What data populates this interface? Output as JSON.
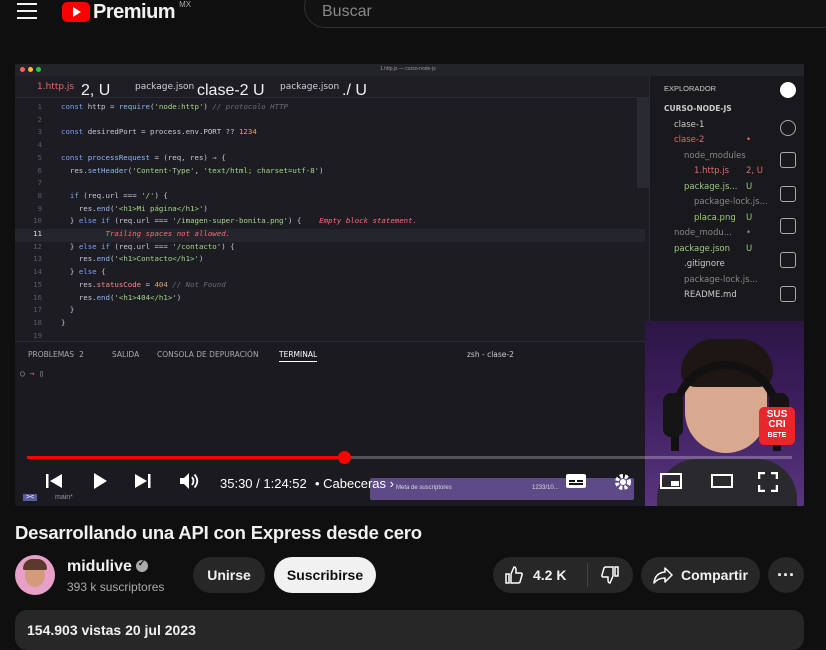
{
  "header": {
    "logo_text": "Premium",
    "logo_sup": "MX",
    "search_placeholder": "Buscar"
  },
  "editor": {
    "window_title": "1.http.js — curso-node-js",
    "tabs": [
      {
        "label": "1.http.js",
        "sub": "2, U",
        "active": true
      },
      {
        "label": "package.json",
        "sub": "clase-2  U",
        "active": false
      },
      {
        "label": "package.json",
        "sub": "./ U",
        "active": false
      }
    ],
    "lines": [
      {
        "n": "1",
        "html": "<span class='kw'>const</span> http = <span class='fn'>require</span>(<span class='str'>'node:http'</span>) <span class='cm'>// protocolo HTTP</span>"
      },
      {
        "n": "2",
        "html": ""
      },
      {
        "n": "3",
        "html": "<span class='kw'>const</span> desiredPort = process.env.PORT ?? <span class='num'>1234</span>"
      },
      {
        "n": "4",
        "html": ""
      },
      {
        "n": "5",
        "html": "<span class='kw'>const</span> <span class='fn'>processRequest</span> = (req, res) ⇒ {"
      },
      {
        "n": "6",
        "html": "  res.<span class='fn'>setHeader</span>(<span class='str'>'Content-Type'</span>, <span class='str'>'text/html; charset=utf-8'</span>)"
      },
      {
        "n": "7",
        "html": ""
      },
      {
        "n": "8",
        "html": "  <span class='kw'>if</span> (req.url === <span class='str'>'/'</span>) {"
      },
      {
        "n": "9",
        "html": "    res.<span class='fn'>end</span>(<span class='str'>'&lt;h1&gt;Mi página&lt;/h1&gt;'</span>)"
      },
      {
        "n": "10",
        "html": "  } <span class='kw'>else if</span> (req.url === <span class='str'>'/imagen-super-bonita.png'</span>) {    <span class='err'>Empty block statement.</span>"
      },
      {
        "n": "11",
        "html": "          <span class='err'>Trailing spaces not allowed.</span>"
      },
      {
        "n": "12",
        "html": "  } <span class='kw'>else if</span> (req.url === <span class='str'>'/contacto'</span>) {"
      },
      {
        "n": "13",
        "html": "    res.<span class='fn'>end</span>(<span class='str'>'&lt;h1&gt;Contacto&lt;/h1&gt;'</span>)"
      },
      {
        "n": "14",
        "html": "  } <span class='kw'>else</span> {"
      },
      {
        "n": "15",
        "html": "    res.<span class='prop'>statusCode</span> = <span class='num'>404</span> <span class='cm'>// Not Found</span>"
      },
      {
        "n": "16",
        "html": "    res.<span class='fn'>end</span>(<span class='str'>'&lt;h1&gt;404&lt;/h1&gt;'</span>)"
      },
      {
        "n": "17",
        "html": "  }"
      },
      {
        "n": "18",
        "html": "}"
      },
      {
        "n": "19",
        "html": ""
      }
    ],
    "explorer_title": "EXPLORADOR",
    "tree": [
      {
        "label": "CURSO-NODE-JS",
        "indent": 0,
        "color": "#cccccc",
        "badge": ""
      },
      {
        "label": "clase-1",
        "indent": 1,
        "color": "#cccccc",
        "badge": ""
      },
      {
        "label": "clase-2",
        "indent": 1,
        "color": "#e36c6c",
        "badge": "•"
      },
      {
        "label": "node_modules",
        "indent": 2,
        "color": "#888888",
        "badge": ""
      },
      {
        "label": "1.http.js",
        "indent": 3,
        "color": "#e36c6c",
        "badge": "2, U"
      },
      {
        "label": "package.js...",
        "indent": 2,
        "color": "#9ecb7a",
        "badge": "U"
      },
      {
        "label": "package-lock.js...",
        "indent": 3,
        "color": "#888888",
        "badge": ""
      },
      {
        "label": "placa.png",
        "indent": 3,
        "color": "#9ecb7a",
        "badge": "U"
      },
      {
        "label": "node_modu...",
        "indent": 1,
        "color": "#888888",
        "badge": "•"
      },
      {
        "label": "package.json",
        "indent": 1,
        "color": "#9ecb7a",
        "badge": "U"
      },
      {
        "label": ".gitignore",
        "indent": 2,
        "color": "#cccccc",
        "badge": ""
      },
      {
        "label": "package-lock.js...",
        "indent": 2,
        "color": "#888888",
        "badge": ""
      },
      {
        "label": "README.md",
        "indent": 2,
        "color": "#cccccc",
        "badge": ""
      }
    ],
    "panel_tabs": [
      {
        "label": "PROBLEMAS",
        "count": "2",
        "active": false
      },
      {
        "label": "SALIDA",
        "count": "",
        "active": false
      },
      {
        "label": "CONSOLA DE DEPURACIÓN",
        "count": "",
        "active": false
      },
      {
        "label": "TERMINAL",
        "count": "",
        "active": true
      }
    ],
    "terminal_name": "zsh - clase-2",
    "status_branch": "main*",
    "toast_text": "Meta de suscriptores",
    "toast_count": "1233/10..."
  },
  "webcam": {
    "badge_lines": [
      "SUS",
      "CRI",
      "BETE"
    ]
  },
  "player": {
    "progress": 0.415,
    "time": "35:30 / 1:24:52",
    "chapter": "Cabeceras",
    "accent": "#ff0000"
  },
  "video": {
    "title": "Desarrollando una API con Express desde cero",
    "channel": "midulive",
    "subscribers": "393 k suscriptores",
    "join_label": "Unirse",
    "subscribe_label": "Suscribirse",
    "likes": "4.2 K",
    "share_label": "Compartir",
    "more_label": "···",
    "description_preview": "154.903 vistas  20 jul 2023"
  }
}
